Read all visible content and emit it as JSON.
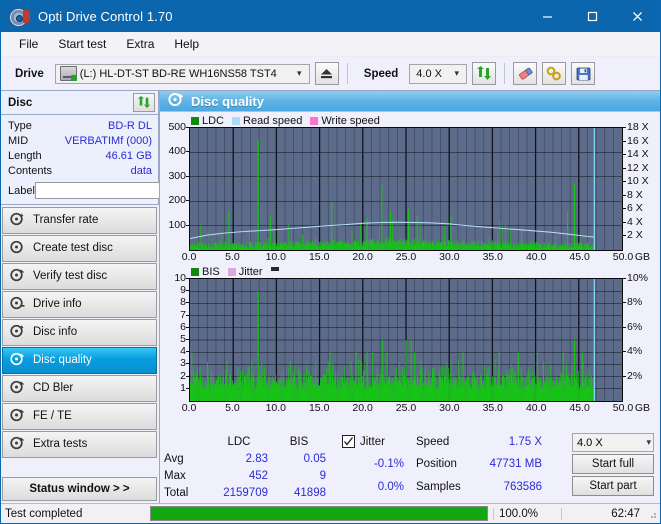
{
  "window": {
    "title": "Opti Drive Control 1.70",
    "icon": "optical-disc-icon",
    "controls": {
      "minimize": "–",
      "maximize": "□",
      "close": "✕"
    }
  },
  "menu": {
    "items": [
      "File",
      "Start test",
      "Extra",
      "Help"
    ]
  },
  "toolbar": {
    "drive_label": "Drive",
    "drive_value": "(L:)  HL-DT-ST BD-RE  WH16NS58 TST4",
    "eject_icon": "eject-icon",
    "speed_label": "Speed",
    "speed_value": "4.0 X",
    "refresh_icon": "refresh-icon",
    "erase_icon": "eraser-icon",
    "tools_icon": "tools-icon",
    "save_icon": "save-icon"
  },
  "disc": {
    "header": "Disc",
    "refresh_icon": "refresh-icon",
    "rows": [
      {
        "key": "Type",
        "value": "BD-R DL"
      },
      {
        "key": "MID",
        "value": "VERBATIMf (000)"
      },
      {
        "key": "Length",
        "value": "46.61 GB"
      },
      {
        "key": "Contents",
        "value": "data"
      }
    ],
    "label_key": "Label",
    "label_value": "",
    "label_placeholder": "",
    "disc_icon": "disc-icon"
  },
  "nav": {
    "items": [
      {
        "label": "Transfer rate",
        "icon": "disc-test-icon",
        "active": false
      },
      {
        "label": "Create test disc",
        "icon": "disc-burn-icon",
        "active": false
      },
      {
        "label": "Verify test disc",
        "icon": "disc-verify-icon",
        "active": false
      },
      {
        "label": "Drive info",
        "icon": "drive-info-icon",
        "active": false
      },
      {
        "label": "Disc info",
        "icon": "disc-info-icon",
        "active": false
      },
      {
        "label": "Disc quality",
        "icon": "disc-quality-icon",
        "active": true
      },
      {
        "label": "CD Bler",
        "icon": "cd-bler-icon",
        "active": false
      },
      {
        "label": "FE / TE",
        "icon": "fe-te-icon",
        "active": false
      },
      {
        "label": "Extra tests",
        "icon": "extra-tests-icon",
        "active": false
      }
    ],
    "status_window": "Status window > >"
  },
  "panel": {
    "title": "Disc quality",
    "title_icon": "disc-quality-icon"
  },
  "stats": {
    "col_headers": [
      "",
      "LDC",
      "BIS"
    ],
    "rows": [
      {
        "label": "Avg",
        "ldc": "2.83",
        "bis": "0.05",
        "jitter": "-0.1%"
      },
      {
        "label": "Max",
        "ldc": "452",
        "bis": "9",
        "jitter": "0.0%"
      },
      {
        "label": "Total",
        "ldc": "2159709",
        "bis": "41898",
        "jitter": ""
      }
    ],
    "jitter_label": "Jitter",
    "jitter_checked": true,
    "speed_label": "Speed",
    "speed_value": "1.75 X",
    "position_label": "Position",
    "position_value": "47731 MB",
    "samples_label": "Samples",
    "samples_value": "763586",
    "speed_select": "4.0 X",
    "start_full": "Start full",
    "start_part": "Start part"
  },
  "statusbar": {
    "text": "Test completed",
    "percent_label": "100.0%",
    "percent": 100,
    "time": "62:47"
  },
  "colors": {
    "accent_blue": "#0b66ad",
    "plot_bg": "#5d6b8a",
    "ldc_green": "#18c318",
    "read_speed": "#a9dcf5",
    "write_speed": "#ff6fd4",
    "jitter": "#d9a9dd",
    "value_blue": "#2b2bd6",
    "progress_green": "#11a811"
  },
  "chart_data": [
    {
      "type": "bar",
      "name": "LDC / Read speed",
      "legend": [
        {
          "label": "LDC",
          "color": "#0f8a0f"
        },
        {
          "label": "Read speed",
          "color": "#a9dcf5"
        },
        {
          "label": "Write speed",
          "color": "#ff6fd4"
        }
      ],
      "legend_position": "top-left",
      "xlabel": "GB",
      "xlim": [
        0,
        50
      ],
      "xticks": [
        "0.0",
        "5.0",
        "10.0",
        "15.0",
        "20.0",
        "25.0",
        "30.0",
        "35.0",
        "40.0",
        "45.0",
        "50.0"
      ],
      "ylabel_left": "LDC",
      "ylim": [
        0,
        500
      ],
      "yticks_left": [
        "100",
        "200",
        "300",
        "400",
        "500"
      ],
      "ylabel_right": "X",
      "ylim_right": [
        0,
        18
      ],
      "yticks_right": [
        "2 X",
        "4 X",
        "6 X",
        "8 X",
        "10 X",
        "12 X",
        "14 X",
        "16 X",
        "18 X"
      ],
      "grid": true,
      "data_end_gb": 46.8,
      "read_speed_curve": [
        {
          "x": 0.0,
          "y": 1.7
        },
        {
          "x": 2.0,
          "y": 2.2
        },
        {
          "x": 4.0,
          "y": 2.5
        },
        {
          "x": 6.0,
          "y": 2.7
        },
        {
          "x": 8.0,
          "y": 2.85
        },
        {
          "x": 10.0,
          "y": 3.0
        },
        {
          "x": 12.0,
          "y": 3.2
        },
        {
          "x": 14.0,
          "y": 3.4
        },
        {
          "x": 16.0,
          "y": 3.6
        },
        {
          "x": 18.0,
          "y": 3.75
        },
        {
          "x": 20.0,
          "y": 3.95
        },
        {
          "x": 22.0,
          "y": 4.05
        },
        {
          "x": 24.0,
          "y": 4.1
        },
        {
          "x": 26.0,
          "y": 4.05
        },
        {
          "x": 28.0,
          "y": 4.0
        },
        {
          "x": 30.0,
          "y": 3.85
        },
        {
          "x": 32.0,
          "y": 3.6
        },
        {
          "x": 34.0,
          "y": 3.4
        },
        {
          "x": 36.0,
          "y": 3.2
        },
        {
          "x": 38.0,
          "y": 3.0
        },
        {
          "x": 40.0,
          "y": 2.8
        },
        {
          "x": 42.0,
          "y": 2.6
        },
        {
          "x": 44.0,
          "y": 2.3
        },
        {
          "x": 46.0,
          "y": 2.0
        },
        {
          "x": 46.8,
          "y": 1.9
        }
      ],
      "ldc_notable_spikes": [
        {
          "x": 7.9,
          "y": 452
        },
        {
          "x": 22.2,
          "y": 265
        },
        {
          "x": 44.5,
          "y": 272
        },
        {
          "x": 16.4,
          "y": 197
        },
        {
          "x": 4.5,
          "y": 157
        },
        {
          "x": 25.3,
          "y": 168
        },
        {
          "x": 23.2,
          "y": 160
        },
        {
          "x": 43.7,
          "y": 156
        },
        {
          "x": 9.3,
          "y": 138
        },
        {
          "x": 20.5,
          "y": 133
        },
        {
          "x": 26.3,
          "y": 140
        },
        {
          "x": 30.2,
          "y": 143
        },
        {
          "x": 46.8,
          "y": 500
        }
      ],
      "ldc_baseline": 25
    },
    {
      "type": "bar",
      "name": "BIS / Jitter",
      "legend": [
        {
          "label": "BIS",
          "color": "#0f8a0f"
        },
        {
          "label": "Jitter",
          "color": "#d9a9dd"
        }
      ],
      "legend_position": "top-left",
      "xlabel": "GB",
      "xlim": [
        0,
        50
      ],
      "xticks": [
        "0.0",
        "5.0",
        "10.0",
        "15.0",
        "20.0",
        "25.0",
        "30.0",
        "35.0",
        "40.0",
        "45.0",
        "50.0"
      ],
      "ylabel_left": "BIS",
      "ylim": [
        0,
        10
      ],
      "yticks_left": [
        "1",
        "2",
        "3",
        "4",
        "5",
        "6",
        "7",
        "8",
        "9",
        "10"
      ],
      "ylabel_right": "%",
      "ylim_right": [
        0,
        10
      ],
      "yticks_right": [
        "2%",
        "4%",
        "6%",
        "8%",
        "10%"
      ],
      "grid": true,
      "data_end_gb": 46.8,
      "bis_notable_spikes": [
        {
          "x": 7.9,
          "y": 9
        },
        {
          "x": 22.3,
          "y": 5
        },
        {
          "x": 25.0,
          "y": 5
        },
        {
          "x": 25.6,
          "y": 5
        },
        {
          "x": 44.5,
          "y": 5
        },
        {
          "x": 0.2,
          "y": 4
        },
        {
          "x": 16.2,
          "y": 4
        },
        {
          "x": 19.2,
          "y": 4
        },
        {
          "x": 20.5,
          "y": 4
        },
        {
          "x": 21.1,
          "y": 4
        },
        {
          "x": 22.8,
          "y": 4
        },
        {
          "x": 26.0,
          "y": 4
        },
        {
          "x": 31.6,
          "y": 4
        },
        {
          "x": 35.8,
          "y": 4
        },
        {
          "x": 38.0,
          "y": 4
        },
        {
          "x": 40.2,
          "y": 4
        },
        {
          "x": 43.2,
          "y": 4
        },
        {
          "x": 45.4,
          "y": 4
        }
      ],
      "bis_baseline": 1.3
    }
  ]
}
